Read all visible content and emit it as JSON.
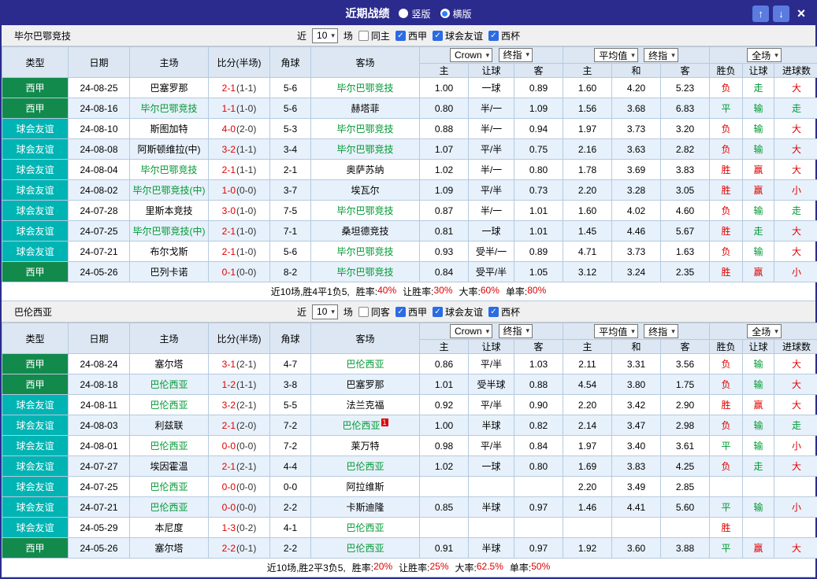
{
  "titlebar": {
    "title": "近期战绩",
    "radios": [
      {
        "label": "竖版",
        "checked": false
      },
      {
        "label": "横版",
        "checked": true
      }
    ],
    "buttons": {
      "up": "↑",
      "down": "↓",
      "close": "×"
    }
  },
  "colors": {
    "titlebar_bg": "#2b2b8e",
    "league_bg": "#128a4c",
    "friendly_bg": "#00b4b4",
    "win_red": "#e00000",
    "draw_green": "#009933",
    "team_highlight": "#009933",
    "row_alt": "#e7f1fb"
  },
  "table_header": {
    "static_cols": [
      "类型",
      "日期",
      "主场",
      "比分(半场)",
      "角球",
      "客场"
    ],
    "group1": {
      "selects": [
        "Crown",
        "终指"
      ],
      "subcols": [
        "主",
        "让球",
        "客"
      ]
    },
    "group2": {
      "selects": [
        "平均值",
        "终指"
      ],
      "subcols": [
        "主",
        "和",
        "客"
      ]
    },
    "group3": {
      "selects": [
        "全场"
      ],
      "subcols": [
        "胜负",
        "让球",
        "进球数"
      ]
    }
  },
  "sections": [
    {
      "team": "毕尔巴鄂竞技",
      "filters": {
        "near": "近",
        "count": "10",
        "games": "场",
        "same": {
          "label": "同主",
          "checked": false
        },
        "comps": [
          {
            "label": "西甲",
            "checked": true
          },
          {
            "label": "球会友谊",
            "checked": true
          },
          {
            "label": "西杯",
            "checked": true
          }
        ]
      },
      "rows": [
        {
          "type": "西甲",
          "tc": "league",
          "date": "24-08-25",
          "home": "巴塞罗那",
          "hh": false,
          "score": "2-1",
          "half": "(1-1)",
          "corner": "5-6",
          "away": "毕尔巴鄂竞技",
          "ah": true,
          "odds": [
            "1.00",
            "一球",
            "0.89",
            "1.60",
            "4.20",
            "5.23"
          ],
          "res": [
            [
              "负",
              "red"
            ],
            [
              "走",
              "green"
            ],
            [
              "大",
              "red"
            ]
          ]
        },
        {
          "type": "西甲",
          "tc": "league",
          "date": "24-08-16",
          "home": "毕尔巴鄂竞技",
          "hh": true,
          "score": "1-1",
          "half": "(1-0)",
          "corner": "5-6",
          "away": "赫塔菲",
          "ah": false,
          "odds": [
            "0.80",
            "半/一",
            "1.09",
            "1.56",
            "3.68",
            "6.83"
          ],
          "res": [
            [
              "平",
              "green"
            ],
            [
              "输",
              "green"
            ],
            [
              "走",
              "green"
            ]
          ]
        },
        {
          "type": "球会友谊",
          "tc": "friendly",
          "date": "24-08-10",
          "home": "斯图加特",
          "hh": false,
          "score": "4-0",
          "half": "(2-0)",
          "corner": "5-3",
          "away": "毕尔巴鄂竞技",
          "ah": true,
          "odds": [
            "0.88",
            "半/一",
            "0.94",
            "1.97",
            "3.73",
            "3.20"
          ],
          "res": [
            [
              "负",
              "red"
            ],
            [
              "输",
              "green"
            ],
            [
              "大",
              "red"
            ]
          ]
        },
        {
          "type": "球会友谊",
          "tc": "friendly",
          "date": "24-08-08",
          "home": "阿斯顿维拉(中)",
          "hh": false,
          "score": "3-2",
          "half": "(1-1)",
          "corner": "3-4",
          "away": "毕尔巴鄂竞技",
          "ah": true,
          "odds": [
            "1.07",
            "平/半",
            "0.75",
            "2.16",
            "3.63",
            "2.82"
          ],
          "res": [
            [
              "负",
              "red"
            ],
            [
              "输",
              "green"
            ],
            [
              "大",
              "red"
            ]
          ]
        },
        {
          "type": "球会友谊",
          "tc": "friendly",
          "date": "24-08-04",
          "home": "毕尔巴鄂竞技",
          "hh": true,
          "score": "2-1",
          "half": "(1-1)",
          "corner": "2-1",
          "away": "奥萨苏纳",
          "ah": false,
          "odds": [
            "1.02",
            "半/一",
            "0.80",
            "1.78",
            "3.69",
            "3.83"
          ],
          "res": [
            [
              "胜",
              "red"
            ],
            [
              "赢",
              "red"
            ],
            [
              "大",
              "red"
            ]
          ]
        },
        {
          "type": "球会友谊",
          "tc": "friendly",
          "date": "24-08-02",
          "home": "毕尔巴鄂竞技(中)",
          "hh": true,
          "score": "1-0",
          "half": "(0-0)",
          "corner": "3-7",
          "away": "埃瓦尔",
          "ah": false,
          "odds": [
            "1.09",
            "平/半",
            "0.73",
            "2.20",
            "3.28",
            "3.05"
          ],
          "res": [
            [
              "胜",
              "red"
            ],
            [
              "赢",
              "red"
            ],
            [
              "小",
              "red"
            ]
          ]
        },
        {
          "type": "球会友谊",
          "tc": "friendly",
          "date": "24-07-28",
          "home": "里斯本竞技",
          "hh": false,
          "score": "3-0",
          "half": "(1-0)",
          "corner": "7-5",
          "away": "毕尔巴鄂竞技",
          "ah": true,
          "odds": [
            "0.87",
            "半/一",
            "1.01",
            "1.60",
            "4.02",
            "4.60"
          ],
          "res": [
            [
              "负",
              "red"
            ],
            [
              "输",
              "green"
            ],
            [
              "走",
              "green"
            ]
          ]
        },
        {
          "type": "球会友谊",
          "tc": "friendly",
          "date": "24-07-25",
          "home": "毕尔巴鄂竞技(中)",
          "hh": true,
          "score": "2-1",
          "half": "(1-0)",
          "corner": "7-1",
          "away": "桑坦德竞技",
          "ah": false,
          "odds": [
            "0.81",
            "一球",
            "1.01",
            "1.45",
            "4.46",
            "5.67"
          ],
          "res": [
            [
              "胜",
              "red"
            ],
            [
              "走",
              "green"
            ],
            [
              "大",
              "red"
            ]
          ]
        },
        {
          "type": "球会友谊",
          "tc": "friendly",
          "date": "24-07-21",
          "home": "布尔戈斯",
          "hh": false,
          "score": "2-1",
          "half": "(1-0)",
          "corner": "5-6",
          "away": "毕尔巴鄂竞技",
          "ah": true,
          "odds": [
            "0.93",
            "受半/一",
            "0.89",
            "4.71",
            "3.73",
            "1.63"
          ],
          "res": [
            [
              "负",
              "red"
            ],
            [
              "输",
              "green"
            ],
            [
              "大",
              "red"
            ]
          ]
        },
        {
          "type": "西甲",
          "tc": "league",
          "date": "24-05-26",
          "home": "巴列卡诺",
          "hh": false,
          "score": "0-1",
          "half": "(0-0)",
          "corner": "8-2",
          "away": "毕尔巴鄂竞技",
          "ah": true,
          "odds": [
            "0.84",
            "受平/半",
            "1.05",
            "3.12",
            "3.24",
            "2.35"
          ],
          "res": [
            [
              "胜",
              "red"
            ],
            [
              "赢",
              "red"
            ],
            [
              "小",
              "red"
            ]
          ]
        }
      ],
      "summary": {
        "prefix": "近10场,胜4平1负5,",
        "stats": [
          [
            "胜率:",
            "40%"
          ],
          [
            "让胜率:",
            "30%"
          ],
          [
            "大率:",
            "60%"
          ],
          [
            "单率:",
            "80%"
          ]
        ]
      }
    },
    {
      "team": "巴伦西亚",
      "filters": {
        "near": "近",
        "count": "10",
        "games": "场",
        "same": {
          "label": "同客",
          "checked": false
        },
        "comps": [
          {
            "label": "西甲",
            "checked": true
          },
          {
            "label": "球会友谊",
            "checked": true
          },
          {
            "label": "西杯",
            "checked": true
          }
        ]
      },
      "rows": [
        {
          "type": "西甲",
          "tc": "league",
          "date": "24-08-24",
          "home": "塞尔塔",
          "hh": false,
          "score": "3-1",
          "half": "(2-1)",
          "corner": "4-7",
          "away": "巴伦西亚",
          "ah": true,
          "odds": [
            "0.86",
            "平/半",
            "1.03",
            "2.11",
            "3.31",
            "3.56"
          ],
          "res": [
            [
              "负",
              "red"
            ],
            [
              "输",
              "green"
            ],
            [
              "大",
              "red"
            ]
          ]
        },
        {
          "type": "西甲",
          "tc": "league",
          "date": "24-08-18",
          "home": "巴伦西亚",
          "hh": true,
          "score": "1-2",
          "half": "(1-1)",
          "corner": "3-8",
          "away": "巴塞罗那",
          "ah": false,
          "odds": [
            "1.01",
            "受半球",
            "0.88",
            "4.54",
            "3.80",
            "1.75"
          ],
          "res": [
            [
              "负",
              "red"
            ],
            [
              "输",
              "green"
            ],
            [
              "大",
              "red"
            ]
          ]
        },
        {
          "type": "球会友谊",
          "tc": "friendly",
          "date": "24-08-11",
          "home": "巴伦西亚",
          "hh": true,
          "score": "3-2",
          "half": "(2-1)",
          "corner": "5-5",
          "away": "法兰克福",
          "ah": false,
          "odds": [
            "0.92",
            "平/半",
            "0.90",
            "2.20",
            "3.42",
            "2.90"
          ],
          "res": [
            [
              "胜",
              "red"
            ],
            [
              "赢",
              "red"
            ],
            [
              "大",
              "red"
            ]
          ]
        },
        {
          "type": "球会友谊",
          "tc": "friendly",
          "date": "24-08-03",
          "home": "利兹联",
          "hh": false,
          "score": "2-1",
          "half": "(2-0)",
          "corner": "7-2",
          "away": "巴伦西亚",
          "ah": true,
          "arc": "1",
          "odds": [
            "1.00",
            "半球",
            "0.82",
            "2.14",
            "3.47",
            "2.98"
          ],
          "res": [
            [
              "负",
              "red"
            ],
            [
              "输",
              "green"
            ],
            [
              "走",
              "green"
            ]
          ]
        },
        {
          "type": "球会友谊",
          "tc": "friendly",
          "date": "24-08-01",
          "home": "巴伦西亚",
          "hh": true,
          "score": "0-0",
          "half": "(0-0)",
          "corner": "7-2",
          "away": "莱万特",
          "ah": false,
          "odds": [
            "0.98",
            "平/半",
            "0.84",
            "1.97",
            "3.40",
            "3.61"
          ],
          "res": [
            [
              "平",
              "green"
            ],
            [
              "输",
              "green"
            ],
            [
              "小",
              "red"
            ]
          ]
        },
        {
          "type": "球会友谊",
          "tc": "friendly",
          "date": "24-07-27",
          "home": "埃因霍温",
          "hh": false,
          "score": "2-1",
          "half": "(2-1)",
          "corner": "4-4",
          "away": "巴伦西亚",
          "ah": true,
          "odds": [
            "1.02",
            "一球",
            "0.80",
            "1.69",
            "3.83",
            "4.25"
          ],
          "res": [
            [
              "负",
              "red"
            ],
            [
              "走",
              "green"
            ],
            [
              "大",
              "red"
            ]
          ]
        },
        {
          "type": "球会友谊",
          "tc": "friendly",
          "date": "24-07-25",
          "home": "巴伦西亚",
          "hh": true,
          "score": "0-0",
          "half": "(0-0)",
          "corner": "0-0",
          "away": "阿拉维斯",
          "ah": false,
          "odds": [
            "",
            "",
            "",
            "2.20",
            "3.49",
            "2.85"
          ],
          "res": [
            [
              "",
              ""
            ],
            [
              "",
              ""
            ],
            [
              "",
              ""
            ]
          ]
        },
        {
          "type": "球会友谊",
          "tc": "friendly",
          "date": "24-07-21",
          "home": "巴伦西亚",
          "hh": true,
          "score": "0-0",
          "half": "(0-0)",
          "corner": "2-2",
          "away": "卡斯迪隆",
          "ah": false,
          "odds": [
            "0.85",
            "半球",
            "0.97",
            "1.46",
            "4.41",
            "5.60"
          ],
          "res": [
            [
              "平",
              "green"
            ],
            [
              "输",
              "green"
            ],
            [
              "小",
              "red"
            ]
          ]
        },
        {
          "type": "球会友谊",
          "tc": "friendly",
          "date": "24-05-29",
          "home": "本尼度",
          "hh": false,
          "score": "1-3",
          "half": "(0-2)",
          "corner": "4-1",
          "away": "巴伦西亚",
          "ah": true,
          "odds": [
            "",
            "",
            "",
            "",
            "",
            ""
          ],
          "res": [
            [
              "胜",
              "red"
            ],
            [
              "",
              ""
            ],
            [
              "",
              ""
            ]
          ]
        },
        {
          "type": "西甲",
          "tc": "league",
          "date": "24-05-26",
          "home": "塞尔塔",
          "hh": false,
          "score": "2-2",
          "half": "(0-1)",
          "corner": "2-2",
          "away": "巴伦西亚",
          "ah": true,
          "odds": [
            "0.91",
            "半球",
            "0.97",
            "1.92",
            "3.60",
            "3.88"
          ],
          "res": [
            [
              "平",
              "green"
            ],
            [
              "赢",
              "red"
            ],
            [
              "大",
              "red"
            ]
          ]
        }
      ],
      "summary": {
        "prefix": "近10场,胜2平3负5,",
        "stats": [
          [
            "胜率:",
            "20%"
          ],
          [
            "让胜率:",
            "25%"
          ],
          [
            "大率:",
            "62.5%"
          ],
          [
            "单率:",
            "50%"
          ]
        ]
      }
    }
  ]
}
